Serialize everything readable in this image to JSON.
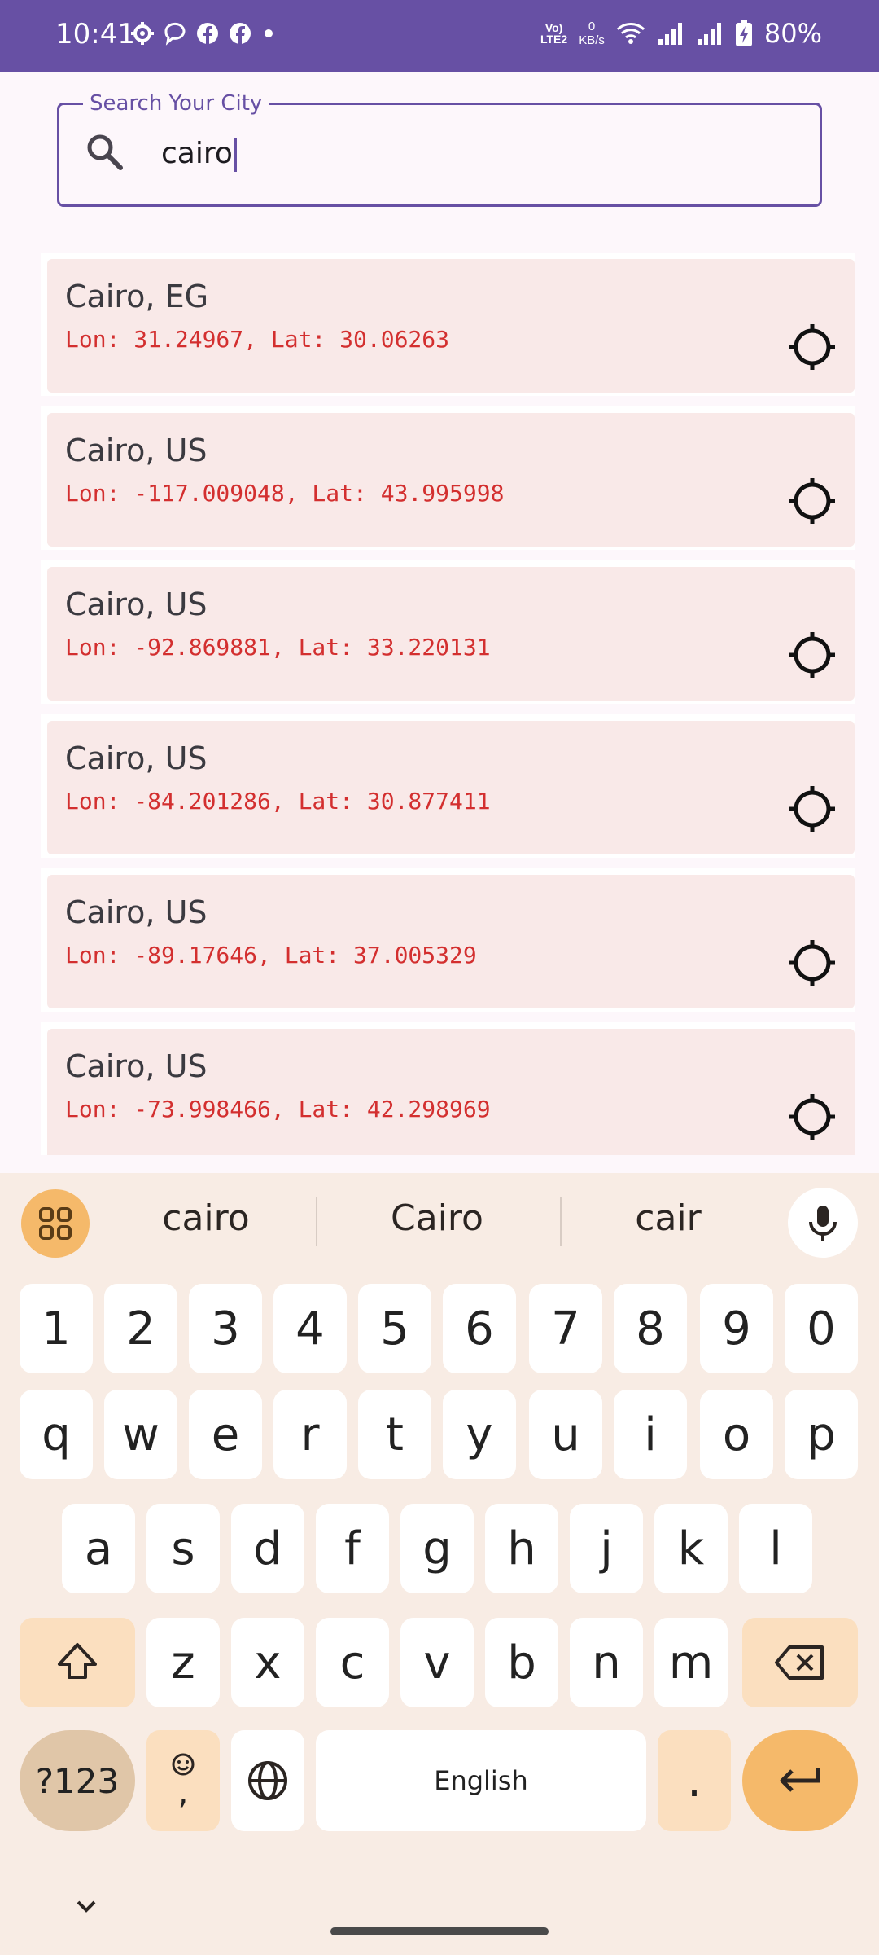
{
  "status_bar": {
    "time": "10:41",
    "network_label": "Vo)\nLTE2",
    "speed_value": "0",
    "speed_unit": "KB/s",
    "battery": "80%"
  },
  "search": {
    "label": "Search Your City",
    "value": "cairo"
  },
  "cities": [
    {
      "name": "Cairo, EG",
      "coords": "Lon: 31.24967, Lat: 30.06263"
    },
    {
      "name": "Cairo, US",
      "coords": "Lon: -117.009048, Lat: 43.995998"
    },
    {
      "name": "Cairo, US",
      "coords": "Lon: -92.869881, Lat: 33.220131"
    },
    {
      "name": "Cairo, US",
      "coords": "Lon: -84.201286, Lat: 30.877411"
    },
    {
      "name": "Cairo, US",
      "coords": "Lon: -89.17646, Lat: 37.005329"
    },
    {
      "name": "Cairo, US",
      "coords": "Lon: -73.998466, Lat: 42.298969"
    }
  ],
  "keyboard": {
    "suggestions": [
      "cairo",
      "Cairo",
      "cair"
    ],
    "row_numbers": [
      "1",
      "2",
      "3",
      "4",
      "5",
      "6",
      "7",
      "8",
      "9",
      "0"
    ],
    "row1": [
      "q",
      "w",
      "e",
      "r",
      "t",
      "y",
      "u",
      "i",
      "o",
      "p"
    ],
    "row2": [
      "a",
      "s",
      "d",
      "f",
      "g",
      "h",
      "j",
      "k",
      "l"
    ],
    "row3": [
      "z",
      "x",
      "c",
      "v",
      "b",
      "n",
      "m"
    ],
    "symbols_label": "?123",
    "comma_label": ",",
    "space_label": "English",
    "period_label": "."
  }
}
